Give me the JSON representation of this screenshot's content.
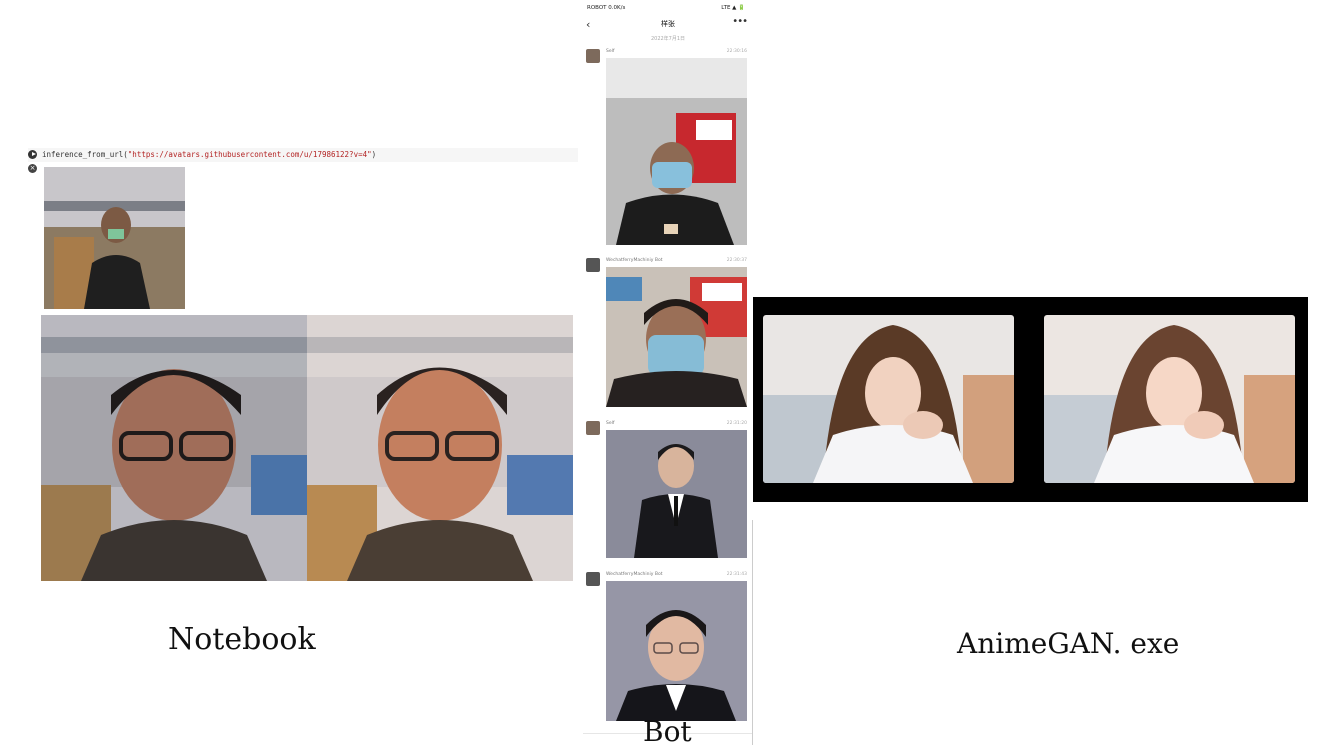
{
  "notebook": {
    "code_function": "inference_from_url(",
    "code_string": "\"https://avatars.githubusercontent.com/u/17986122?v=4\"",
    "code_close": ")",
    "caption": "Notebook"
  },
  "bot": {
    "caption": "Bot",
    "status_left": "ROBOT 0.0K/s",
    "status_right": "LTE ▲ 🔋",
    "title": "样张",
    "date": "2022年7月1日",
    "messages": [
      {
        "name": "Self",
        "time": "22:30:16"
      },
      {
        "name": "WechatferryMachiniy Bot",
        "time": "22:30:37"
      },
      {
        "name": "Self",
        "time": "22:31:20"
      },
      {
        "name": "WechatferryMachiniy Bot",
        "time": "22:31:43"
      }
    ]
  },
  "exe": {
    "caption": "AnimeGAN. exe"
  },
  "icons": {
    "run": "play-icon",
    "clear": "clear-output-icon",
    "back": "chevron-left-icon",
    "more": "more-icon"
  }
}
